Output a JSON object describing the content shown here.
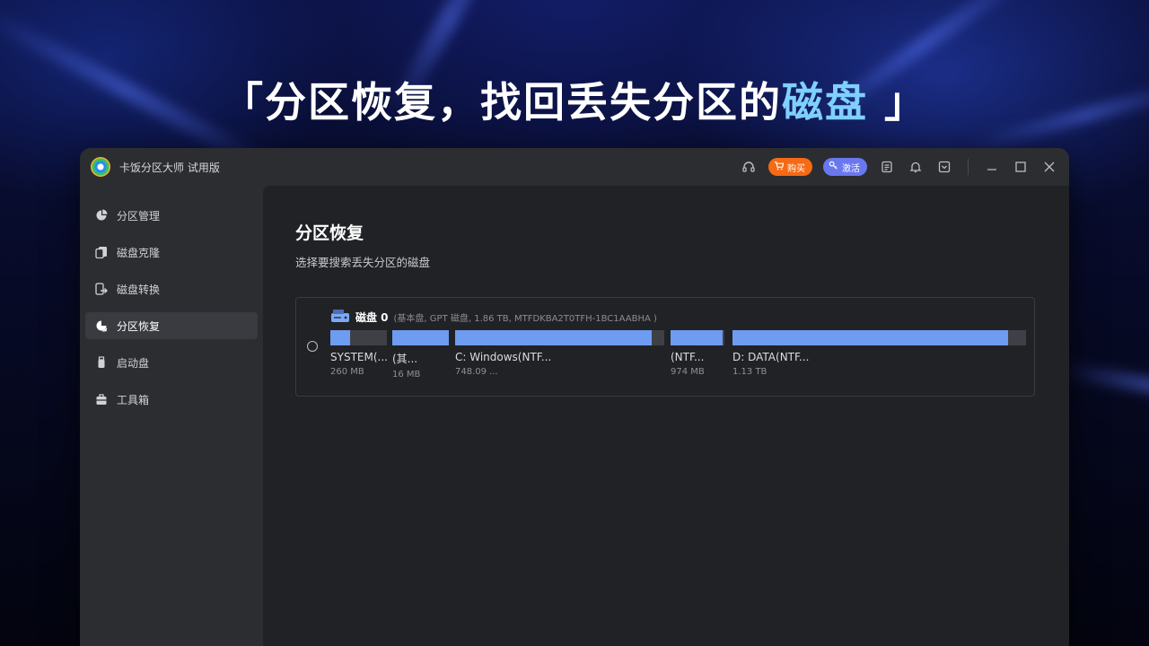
{
  "headline": {
    "part1": "「分区恢复，找回丢失分区的",
    "part2": "磁盘",
    "part3": " 」"
  },
  "app": {
    "title": "卡饭分区大师 试用版",
    "buy_label": "购买",
    "activate_label": "激活",
    "accent": "#6d9cf0"
  },
  "sidebar": {
    "items": [
      {
        "label": "分区管理",
        "icon": "pie-chart-icon"
      },
      {
        "label": "磁盘克隆",
        "icon": "clone-icon"
      },
      {
        "label": "磁盘转换",
        "icon": "convert-icon"
      },
      {
        "label": "分区恢复",
        "icon": "recovery-icon",
        "active": true
      },
      {
        "label": "启动盘",
        "icon": "usb-icon"
      },
      {
        "label": "工具箱",
        "icon": "toolbox-icon"
      }
    ]
  },
  "main": {
    "title": "分区恢复",
    "subtitle": "选择要搜索丢失分区的磁盘",
    "disk": {
      "name": "磁盘 0",
      "info": "(基本盘, GPT 磁盘, 1.86 TB, MTFDKBA2T0TFH-1BC1AABHA )",
      "partitions": [
        {
          "name": "SYSTEM(...",
          "size": "260 MB",
          "used": 0.35
        },
        {
          "name": "(其...",
          "size": "16 MB",
          "used": 1.0
        },
        {
          "name": "C: Windows(NTF...",
          "size": "748.09 ...",
          "used": 0.94
        },
        {
          "name": "(NTF...",
          "size": "974 MB",
          "used": 0.96
        },
        {
          "name": "D: DATA(NTF...",
          "size": "1.13 TB",
          "used": 0.94
        }
      ]
    }
  }
}
